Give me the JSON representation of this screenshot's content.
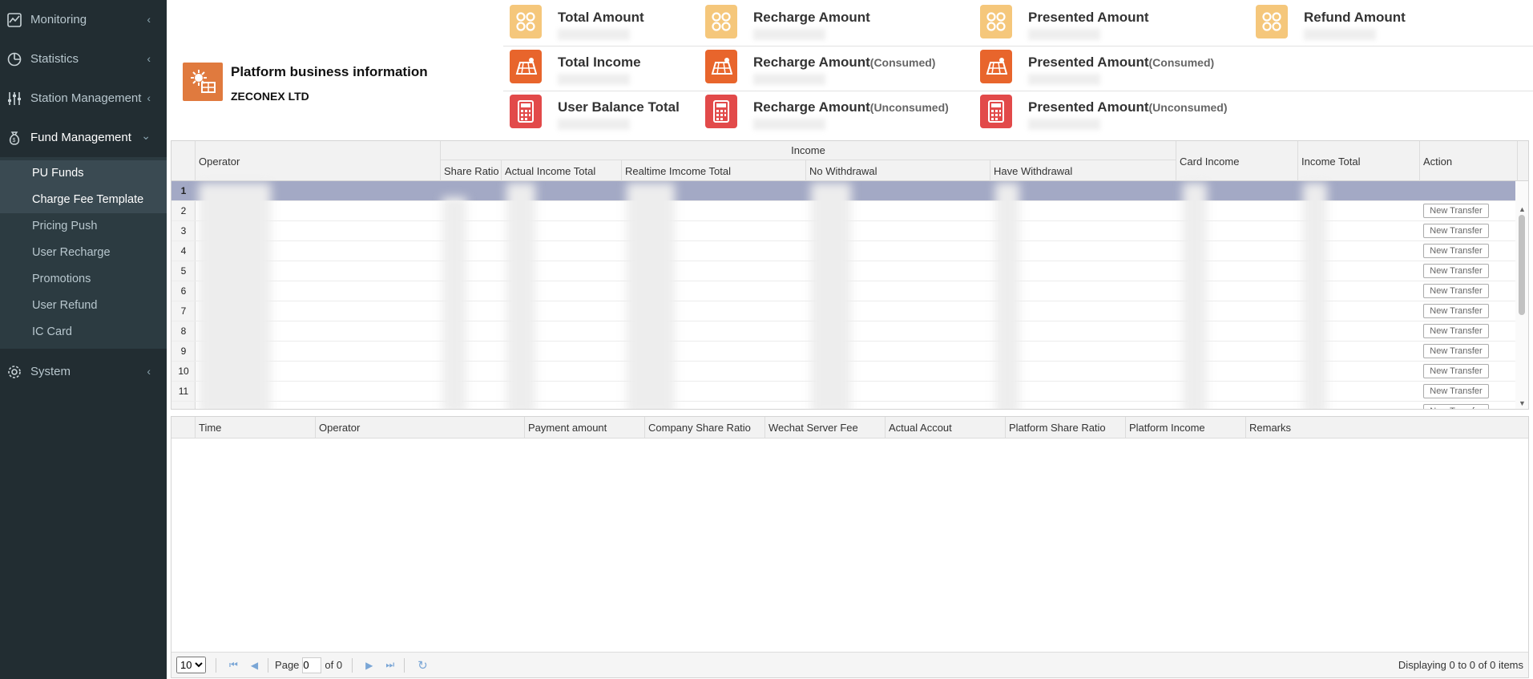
{
  "sidebar": {
    "items": [
      {
        "label": "Monitoring"
      },
      {
        "label": "Statistics"
      },
      {
        "label": "Station Management"
      },
      {
        "label": "Fund Management"
      },
      {
        "label": "System"
      }
    ],
    "fund_sub": [
      {
        "label": "PU Funds"
      },
      {
        "label": "Charge Fee Template"
      },
      {
        "label": "Pricing Push"
      },
      {
        "label": "User Recharge"
      },
      {
        "label": "Promotions"
      },
      {
        "label": "User Refund"
      },
      {
        "label": "IC Card"
      }
    ]
  },
  "business": {
    "title": "Platform business information",
    "company": "ZECONEX LTD"
  },
  "stats": {
    "total_amount": "Total Amount",
    "recharge_amount": "Recharge Amount",
    "presented_amount": "Presented Amount",
    "refund_amount": "Refund Amount",
    "total_income": "Total Income",
    "recharge_consumed": "Recharge Amount",
    "presented_consumed": "Presented Amount",
    "consumed_suffix": "(Consumed)",
    "user_balance_total": "User Balance Total",
    "recharge_unconsumed": "Recharge Amount",
    "presented_unconsumed": "Presented Amount",
    "unconsumed_suffix": "(Unconsumed)"
  },
  "top_grid": {
    "headers": {
      "operator": "Operator",
      "income": "Income",
      "share_ratio": "Share Ratio",
      "actual_income_total": "Actual Income Total",
      "realtime_income_total": "Realtime Imcome Total",
      "no_withdrawal": "No Withdrawal",
      "have_withdrawal": "Have Withdrawal",
      "card_income": "Card Income",
      "income_total": "Income Total",
      "action": "Action"
    },
    "rows": [
      "1",
      "2",
      "3",
      "4",
      "5",
      "6",
      "7",
      "8",
      "9",
      "10",
      "11"
    ],
    "row_button_label": "New Transfer"
  },
  "bottom_grid": {
    "headers": [
      "Time",
      "Operator",
      "Payment amount",
      "Company Share Ratio",
      "Wechat Server Fee",
      "Actual Accout",
      "Platform Share Ratio",
      "Platform Income",
      "Remarks"
    ]
  },
  "pager": {
    "page_size": "10",
    "page_label": "Page",
    "page_value": "0",
    "of_label": "of 0",
    "display_text": "Displaying 0 to 0 of 0 items"
  },
  "colors": {
    "sidebar_bg": "#222d32",
    "selected_row": "#a3a9c5",
    "icon_yellow": "#f5c77b",
    "icon_orange": "#e8652c",
    "icon_red": "#e24a4a"
  }
}
